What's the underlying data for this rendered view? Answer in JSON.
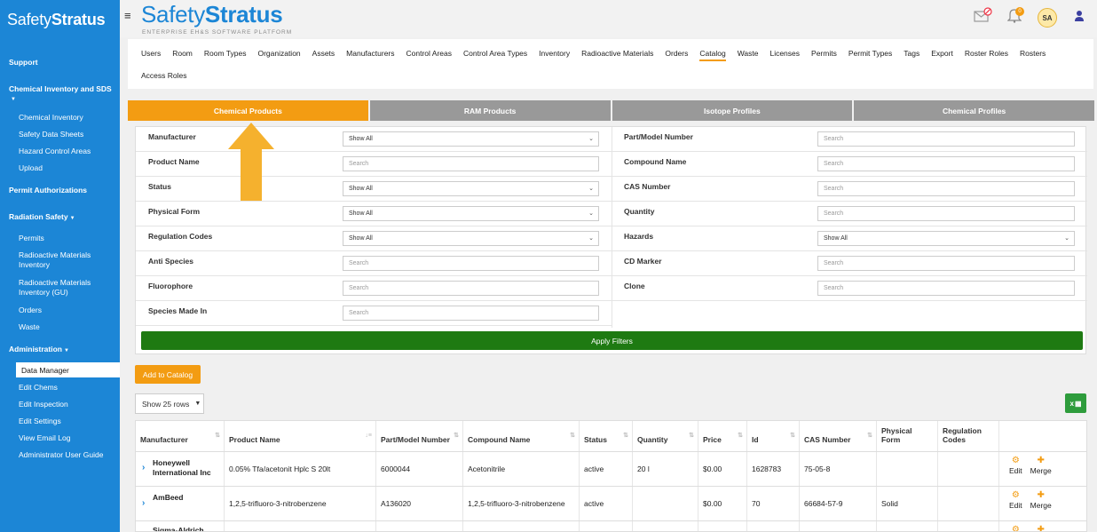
{
  "sidebar": {
    "logo_light": "Safety",
    "logo_bold": "Stratus",
    "sections": {
      "support": "Support",
      "chem": "Chemical Inventory and SDS",
      "permit_auth": "Permit Authorizations",
      "radiation": "Radiation Safety",
      "admin": "Administration"
    },
    "chem_items": [
      "Chemical Inventory",
      "Safety Data Sheets",
      "Hazard Control Areas",
      "Upload"
    ],
    "rad_items": [
      "Permits",
      "Radioactive Materials Inventory",
      "Radioactive Materials Inventory (GU)",
      "Orders",
      "Waste"
    ],
    "admin_items": [
      "Data Manager",
      "Edit Chems",
      "Edit Inspection",
      "Edit Settings",
      "View Email Log",
      "Administrator User Guide"
    ]
  },
  "header": {
    "brand_light": "Safety",
    "brand_bold": "Stratus",
    "subtitle": "ENTERPRISE EH&S SOFTWARE PLATFORM",
    "notification_count": "0",
    "avatar": "SA"
  },
  "nav": {
    "row1": [
      "Users",
      "Room",
      "Room Types",
      "Organization",
      "Assets",
      "Manufacturers",
      "Control Areas",
      "Control Area Types",
      "Inventory",
      "Radioactive Materials",
      "Orders",
      "Catalog",
      "Waste",
      "Licenses",
      "Permits",
      "Permit Types",
      "Tags",
      "Export",
      "Roster Roles",
      "Rosters"
    ],
    "row2": [
      "Access Roles"
    ],
    "active": "Catalog"
  },
  "tabs": [
    "Chemical Products",
    "RAM Products",
    "Isotope Profiles",
    "Chemical Profiles"
  ],
  "filters": {
    "left": [
      {
        "label": "Manufacturer",
        "value": "Show All",
        "type": "select"
      },
      {
        "label": "Product Name",
        "value": "Search",
        "type": "input"
      },
      {
        "label": "Status",
        "value": "Show All",
        "type": "select"
      },
      {
        "label": "Physical Form",
        "value": "Show All",
        "type": "select"
      },
      {
        "label": "Regulation Codes",
        "value": "Show All",
        "type": "select"
      },
      {
        "label": "Anti Species",
        "value": "Search",
        "type": "input"
      },
      {
        "label": "Fluorophore",
        "value": "Search",
        "type": "input"
      },
      {
        "label": "Species Made In",
        "value": "Search",
        "type": "input"
      }
    ],
    "right": [
      {
        "label": "Part/Model Number",
        "value": "Search",
        "type": "input"
      },
      {
        "label": "Compound Name",
        "value": "Search",
        "type": "input"
      },
      {
        "label": "CAS Number",
        "value": "Search",
        "type": "input"
      },
      {
        "label": "Quantity",
        "value": "Search",
        "type": "input"
      },
      {
        "label": "Hazards",
        "value": "Show All",
        "type": "select"
      },
      {
        "label": "CD Marker",
        "value": "Search",
        "type": "input"
      },
      {
        "label": "Clone",
        "value": "Search",
        "type": "input"
      }
    ],
    "apply_label": "Apply Filters"
  },
  "add_label": "Add to Catalog",
  "show_rows": "Show 25 rows",
  "excel_label": "x",
  "table": {
    "headers": [
      "Manufacturer",
      "Product Name",
      "Part/Model Number",
      "Compound Name",
      "Status",
      "Quantity",
      "Price",
      "Id",
      "CAS Number",
      "Physical Form",
      "Regulation Codes"
    ],
    "rows": [
      [
        "Honeywell International Inc",
        "0.05% Tfa/acetonit Hplc S 20lt",
        "6000044",
        "Acetonitrile",
        "active",
        "20 l",
        "$0.00",
        "1628783",
        "75-05-8",
        "",
        ""
      ],
      [
        "AmBeed",
        "1,2,5-trifluoro-3-nitrobenzene",
        "A136020",
        "1,2,5-trifluoro-3-nitrobenzene",
        "active",
        "",
        "$0.00",
        "70",
        "66684-57-9",
        "Solid",
        ""
      ],
      [
        "Sigma-Aldrich",
        "",
        "",
        "",
        "",
        "",
        "",
        "",
        "",
        "",
        ""
      ]
    ],
    "edit_label": "Edit",
    "merge_label": "Merge"
  }
}
